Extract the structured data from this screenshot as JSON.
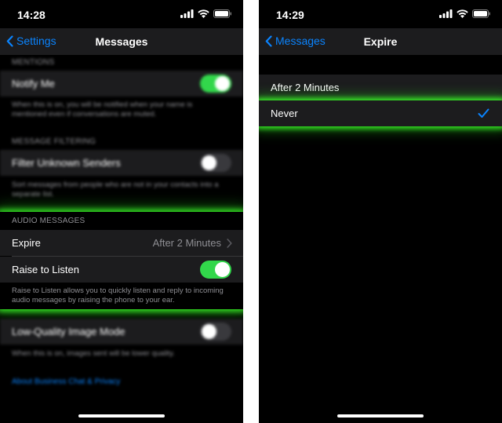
{
  "left": {
    "status": {
      "time": "14:28"
    },
    "nav": {
      "back_label": "Settings",
      "title": "Messages"
    },
    "mentions": {
      "header": "MENTIONS",
      "notify_label": "Notify Me",
      "notify_on": true,
      "footer": "When this is on, you will be notified when your name is mentioned even if conversations are muted."
    },
    "filtering": {
      "header": "MESSAGE FILTERING",
      "filter_label": "Filter Unknown Senders",
      "filter_on": false,
      "footer": "Sort messages from people who are not in your contacts into a separate list."
    },
    "audio": {
      "header": "AUDIO MESSAGES",
      "expire_label": "Expire",
      "expire_value": "After 2 Minutes",
      "raise_label": "Raise to Listen",
      "raise_on": true,
      "footer": "Raise to Listen allows you to quickly listen and reply to incoming audio messages by raising the phone to your ear."
    },
    "lowquality": {
      "label": "Low-Quality Image Mode",
      "on": false,
      "footer": "When this is on, images sent will be lower quality."
    },
    "link": "About Business Chat & Privacy"
  },
  "right": {
    "status": {
      "time": "14:29"
    },
    "nav": {
      "back_label": "Messages",
      "title": "Expire"
    },
    "options": [
      {
        "label": "After 2 Minutes",
        "selected": false
      },
      {
        "label": "Never",
        "selected": true
      }
    ]
  },
  "colors": {
    "accent": "#0a84ff",
    "toggle_on": "#32d74b",
    "highlight": "#3cff28"
  }
}
